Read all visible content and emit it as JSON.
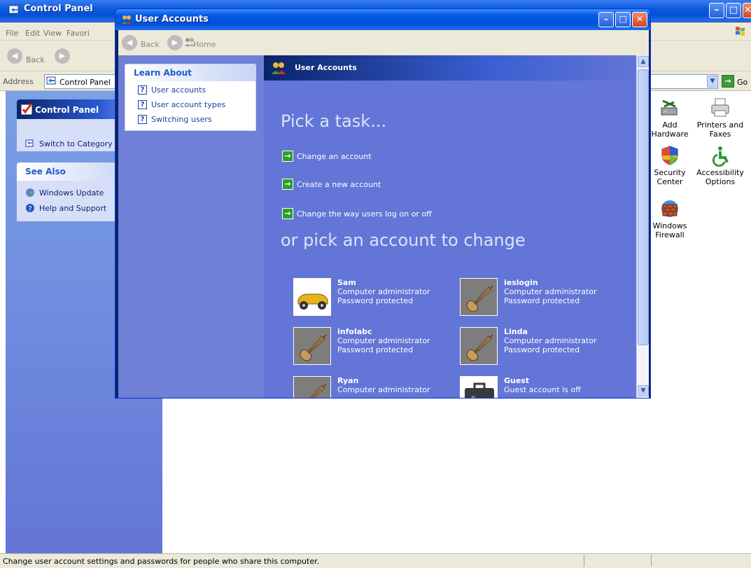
{
  "control_panel": {
    "title": "Control Panel",
    "menu": [
      "File",
      "Edit",
      "View",
      "Favori"
    ],
    "toolbar": {
      "back_label": "Back"
    },
    "address": {
      "label": "Address",
      "value": "Control Panel",
      "go_label": "Go"
    },
    "taskpane": {
      "header": "Control Panel",
      "switch_link": "Switch to Category V",
      "see_also_header": "See Also",
      "see_also_links": [
        "Windows Update",
        "Help and Support"
      ]
    },
    "items": [
      {
        "label": "Add Hardware",
        "icon": "add-hardware-icon"
      },
      {
        "label": "Printers and Faxes",
        "icon": "printer-icon"
      },
      {
        "label": "Security Center",
        "icon": "security-shield-icon"
      },
      {
        "label": "Accessibility Options",
        "icon": "accessibility-icon"
      },
      {
        "label": "Windows Firewall",
        "icon": "firewall-icon"
      }
    ],
    "status_text": "Change user account settings and passwords for people who share this computer."
  },
  "user_accounts": {
    "title": "User Accounts",
    "nav": {
      "back_label": "Back",
      "home_label": "Home"
    },
    "learn_about": {
      "header": "Learn About",
      "links": [
        "User accounts",
        "User account types",
        "Switching users"
      ]
    },
    "main_header": "User Accounts",
    "pick_task": "Pick a task...",
    "tasks": [
      "Change an account",
      "Create a new account",
      "Change the way users log on or off"
    ],
    "pick_account": "or pick an account to change",
    "accounts": [
      {
        "name": "Sam",
        "line1": "Computer administrator",
        "line2": "Password protected",
        "picture": "car-picture"
      },
      {
        "name": "ieslogin",
        "line1": "Computer administrator",
        "line2": "Password protected",
        "picture": "guitar-picture"
      },
      {
        "name": "infolabc",
        "line1": "Computer administrator",
        "line2": "Password protected",
        "picture": "guitar-picture"
      },
      {
        "name": "Linda",
        "line1": "Computer administrator",
        "line2": "Password protected",
        "picture": "guitar-picture"
      },
      {
        "name": "Ryan",
        "line1": "Computer administrator",
        "line2": "",
        "picture": "guitar-picture"
      },
      {
        "name": "Guest",
        "line1": "Guest account is off",
        "line2": "",
        "picture": "briefcase-picture"
      }
    ]
  },
  "colors": {
    "xp_title_blue": "#0451d6",
    "taskpane_blue": "#6375d6",
    "go_green": "#3c9c3c",
    "close_red": "#d2461e"
  }
}
